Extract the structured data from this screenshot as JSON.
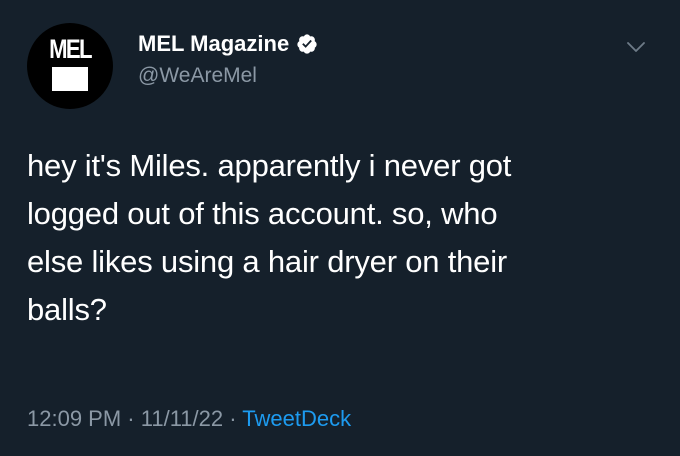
{
  "account": {
    "display_name": "MEL Magazine",
    "handle": "@WeAreMel",
    "avatar_text": "MEL",
    "verified": true
  },
  "tweet": {
    "lines": [
      "hey it's Miles. apparently i never got",
      "logged out of this account. so, who",
      "else likes using a hair dryer on their",
      "balls?"
    ],
    "time": "12:09 PM",
    "separator": "·",
    "date": "11/11/22",
    "source": "TweetDeck"
  },
  "colors": {
    "background": "#15202b",
    "text": "#ffffff",
    "secondary": "#8b98a5",
    "accent": "#1d9bf0"
  },
  "icons": {
    "verified": "verified-badge-icon",
    "menu": "chevron-down-icon"
  }
}
